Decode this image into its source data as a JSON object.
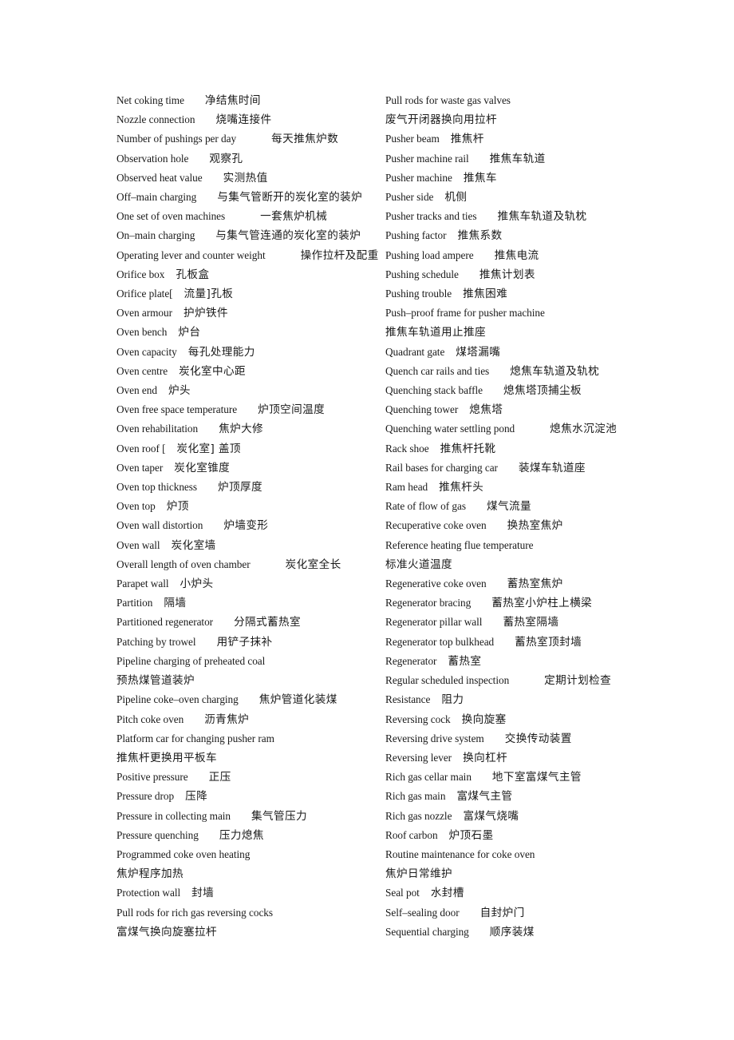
{
  "document": {
    "type": "bilingual-glossary",
    "language_pair": "English-Chinese",
    "columns": 2
  },
  "left_column": [
    {
      "en": "Net coking time",
      "zh": "净结焦时间",
      "gap": "gap-md",
      "wrapped": false
    },
    {
      "en": "Nozzle connection",
      "zh": "烧嘴连接件",
      "gap": "gap-md",
      "wrapped": false
    },
    {
      "en": "Number of pushings per day",
      "zh": "每天推焦炉数",
      "gap": "gap-lg",
      "wrapped": false
    },
    {
      "en": "Observation hole",
      "zh": "观察孔",
      "gap": "gap-md",
      "wrapped": false
    },
    {
      "en": "Observed heat value",
      "zh": "实测热值",
      "gap": "gap-md",
      "wrapped": false
    },
    {
      "en": "Off–main charging",
      "zh": "与集气管断开的炭化室的装炉",
      "gap": "gap-md",
      "wrapped": false
    },
    {
      "en": "One set of oven machines",
      "zh": "一套焦炉机械",
      "gap": "gap-lg",
      "wrapped": false
    },
    {
      "en": "On–main charging",
      "zh": "与集气管连通的炭化室的装炉",
      "gap": "gap-md",
      "wrapped": false
    },
    {
      "en": "Operating lever and counter weight",
      "zh": "操作拉杆及配重",
      "gap": "gap-lg",
      "wrapped": false
    },
    {
      "en": "Orifice box",
      "zh": "孔板盒",
      "gap": "gap-sm",
      "wrapped": false
    },
    {
      "en": "Orifice plate[",
      "zh": "流量]孔板",
      "gap": "gap-sm",
      "wrapped": false
    },
    {
      "en": "Oven armour",
      "zh": "护炉铁件",
      "gap": "gap-sm",
      "wrapped": false
    },
    {
      "en": "Oven bench",
      "zh": "炉台",
      "gap": "gap-sm",
      "wrapped": false
    },
    {
      "en": "Oven capacity",
      "zh": "每孔处理能力",
      "gap": "gap-sm",
      "wrapped": false
    },
    {
      "en": "Oven centre",
      "zh": "炭化室中心距",
      "gap": "gap-sm",
      "wrapped": false
    },
    {
      "en": "Oven end",
      "zh": "炉头",
      "gap": "gap-sm",
      "wrapped": false
    },
    {
      "en": "Oven free space temperature",
      "zh": "炉顶空间温度",
      "gap": "gap-md",
      "wrapped": false
    },
    {
      "en": "Oven rehabilitation",
      "zh": "焦炉大修",
      "gap": "gap-md",
      "wrapped": false
    },
    {
      "en": "Oven roof [",
      "zh": "炭化室] 盖顶",
      "gap": "gap-sm",
      "wrapped": false
    },
    {
      "en": "Oven taper",
      "zh": "炭化室锥度",
      "gap": "gap-sm",
      "wrapped": false
    },
    {
      "en": "Oven top thickness",
      "zh": "炉顶厚度",
      "gap": "gap-md",
      "wrapped": false
    },
    {
      "en": "Oven top",
      "zh": "炉顶",
      "gap": "gap-sm",
      "wrapped": false
    },
    {
      "en": "Oven wall distortion",
      "zh": "炉墙变形",
      "gap": "gap-md",
      "wrapped": false
    },
    {
      "en": "Oven wall",
      "zh": "炭化室墙",
      "gap": "gap-sm",
      "wrapped": false
    },
    {
      "en": "Overall length of oven chamber",
      "zh": "炭化室全长",
      "gap": "gap-lg",
      "wrapped": false
    },
    {
      "en": "Parapet wall",
      "zh": "小炉头",
      "gap": "gap-sm",
      "wrapped": false
    },
    {
      "en": "Partition",
      "zh": "隔墙",
      "gap": "gap-sm",
      "wrapped": false
    },
    {
      "en": "Partitioned regenerator",
      "zh": "分隔式蓄热室",
      "gap": "gap-md",
      "wrapped": false
    },
    {
      "en": "Patching by trowel",
      "zh": "用铲子抹补",
      "gap": "gap-md",
      "wrapped": false
    },
    {
      "en": "Pipeline charging of preheated coal",
      "zh": "预热煤管道装炉",
      "gap": "",
      "wrapped": true
    },
    {
      "en": "Pipeline coke–oven charging",
      "zh": "焦炉管道化装煤",
      "gap": "gap-md",
      "wrapped": false
    },
    {
      "en": "Pitch coke oven",
      "zh": "沥青焦炉",
      "gap": "gap-md",
      "wrapped": false
    },
    {
      "en": "Platform car for changing pusher ram",
      "zh": "推焦杆更换用平板车",
      "gap": "",
      "wrapped": true
    },
    {
      "en": "Positive pressure",
      "zh": "正压",
      "gap": "gap-md",
      "wrapped": false
    },
    {
      "en": "Pressure drop",
      "zh": "压降",
      "gap": "gap-sm",
      "wrapped": false
    },
    {
      "en": "Pressure in collecting main",
      "zh": "集气管压力",
      "gap": "gap-md",
      "wrapped": false
    },
    {
      "en": "Pressure quenching",
      "zh": "压力熄焦",
      "gap": "gap-md",
      "wrapped": false
    },
    {
      "en": "Programmed coke oven heating",
      "zh": "焦炉程序加热",
      "gap": "",
      "wrapped": true
    },
    {
      "en": "Protection wall",
      "zh": "封墙",
      "gap": "gap-sm",
      "wrapped": false
    },
    {
      "en": "Pull rods for rich gas reversing cocks",
      "zh": "富煤气换向旋塞拉杆",
      "gap": "",
      "wrapped": true
    }
  ],
  "right_column": [
    {
      "en": "Pull rods for waste gas valves",
      "zh": "废气开闭器换向用拉杆",
      "gap": "",
      "wrapped": true
    },
    {
      "en": "Pusher beam",
      "zh": "推焦杆",
      "gap": "gap-sm",
      "wrapped": false
    },
    {
      "en": "Pusher machine rail",
      "zh": "推焦车轨道",
      "gap": "gap-md",
      "wrapped": false
    },
    {
      "en": "Pusher machine",
      "zh": "推焦车",
      "gap": "gap-sm",
      "wrapped": false
    },
    {
      "en": "Pusher side",
      "zh": "机侧",
      "gap": "gap-sm",
      "wrapped": false
    },
    {
      "en": "Pusher tracks and ties",
      "zh": "推焦车轨道及轨枕",
      "gap": "gap-md",
      "wrapped": false
    },
    {
      "en": "Pushing factor",
      "zh": "推焦系数",
      "gap": "gap-sm",
      "wrapped": false
    },
    {
      "en": "Pushing load ampere",
      "zh": "推焦电流",
      "gap": "gap-md",
      "wrapped": false
    },
    {
      "en": "Pushing schedule",
      "zh": "推焦计划表",
      "gap": "gap-md",
      "wrapped": false
    },
    {
      "en": "Pushing trouble",
      "zh": "推焦困难",
      "gap": "gap-sm",
      "wrapped": false
    },
    {
      "en": "Push–proof frame for pusher machine",
      "zh": "推焦车轨道用止推座",
      "gap": "",
      "wrapped": true
    },
    {
      "en": "Quadrant gate",
      "zh": "煤塔漏嘴",
      "gap": "gap-sm",
      "wrapped": false
    },
    {
      "en": "Quench car rails and ties",
      "zh": "熄焦车轨道及轨枕",
      "gap": "gap-md",
      "wrapped": false
    },
    {
      "en": "Quenching stack baffle",
      "zh": "熄焦塔顶捕尘板",
      "gap": "gap-md",
      "wrapped": false
    },
    {
      "en": "Quenching tower",
      "zh": "熄焦塔",
      "gap": "gap-sm",
      "wrapped": false
    },
    {
      "en": "Quenching water settling pond",
      "zh": "熄焦水沉淀池",
      "gap": "gap-lg",
      "wrapped": false
    },
    {
      "en": "Rack shoe",
      "zh": "推焦杆托靴",
      "gap": "gap-sm",
      "wrapped": false
    },
    {
      "en": "Rail bases for charging car",
      "zh": "装煤车轨道座",
      "gap": "gap-md",
      "wrapped": false
    },
    {
      "en": "Ram head",
      "zh": "推焦杆头",
      "gap": "gap-sm",
      "wrapped": false
    },
    {
      "en": "Rate of flow of gas",
      "zh": "煤气流量",
      "gap": "gap-md",
      "wrapped": false
    },
    {
      "en": "Recuperative coke oven",
      "zh": "换热室焦炉",
      "gap": "gap-md",
      "wrapped": false
    },
    {
      "en": "Reference heating flue temperature",
      "zh": "标准火道温度",
      "gap": "",
      "wrapped": true
    },
    {
      "en": "Regenerative coke oven",
      "zh": "蓄热室焦炉",
      "gap": "gap-md",
      "wrapped": false
    },
    {
      "en": "Regenerator bracing",
      "zh": "蓄热室小炉柱上横梁",
      "gap": "gap-md",
      "wrapped": false
    },
    {
      "en": "Regenerator pillar wall",
      "zh": "蓄热室隔墙",
      "gap": "gap-md",
      "wrapped": false
    },
    {
      "en": "Regenerator top bulkhead",
      "zh": "蓄热室顶封墙",
      "gap": "gap-md",
      "wrapped": false
    },
    {
      "en": "Regenerator",
      "zh": "蓄热室",
      "gap": "gap-sm",
      "wrapped": false
    },
    {
      "en": "Regular scheduled inspection",
      "zh": "定期计划检查",
      "gap": "gap-lg",
      "wrapped": false
    },
    {
      "en": "Resistance",
      "zh": "阻力",
      "gap": "gap-sm",
      "wrapped": false
    },
    {
      "en": "Reversing cock",
      "zh": "换向旋塞",
      "gap": "gap-sm",
      "wrapped": false
    },
    {
      "en": "Reversing drive system",
      "zh": "交换传动装置",
      "gap": "gap-md",
      "wrapped": false
    },
    {
      "en": "Reversing lever",
      "zh": "换向杠杆",
      "gap": "gap-sm",
      "wrapped": false
    },
    {
      "en": "Rich gas cellar main",
      "zh": "地下室富煤气主管",
      "gap": "gap-md",
      "wrapped": false
    },
    {
      "en": "Rich gas main",
      "zh": "富煤气主管",
      "gap": "gap-sm",
      "wrapped": false
    },
    {
      "en": "Rich gas nozzle",
      "zh": "富煤气烧嘴",
      "gap": "gap-sm",
      "wrapped": false
    },
    {
      "en": "Roof carbon",
      "zh": "炉顶石墨",
      "gap": "gap-sm",
      "wrapped": false
    },
    {
      "en": "Routine maintenance for coke oven",
      "zh": "焦炉日常维护",
      "gap": "",
      "wrapped": true
    },
    {
      "en": "Seal pot",
      "zh": "水封槽",
      "gap": "gap-sm",
      "wrapped": false
    },
    {
      "en": "Self–sealing door",
      "zh": "自封炉门",
      "gap": "gap-md",
      "wrapped": false
    },
    {
      "en": "Sequential charging",
      "zh": "顺序装煤",
      "gap": "gap-md",
      "wrapped": false
    }
  ]
}
